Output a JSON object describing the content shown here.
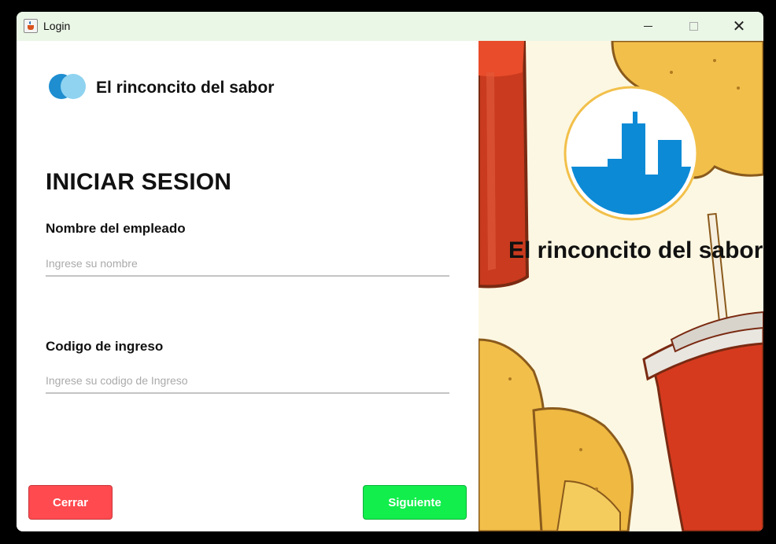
{
  "window": {
    "title": "Login",
    "controls": {
      "minimize": "minimize",
      "maximize": "maximize",
      "close": "✕"
    }
  },
  "brand": {
    "name": "El rinconcito del sabor"
  },
  "login": {
    "heading": "INICIAR SESION",
    "employee_label": "Nombre del empleado",
    "employee_placeholder": "Ingrese su nombre",
    "code_label": "Codigo de ingreso",
    "code_placeholder": "Ingrese su codigo de Ingreso"
  },
  "buttons": {
    "close_label": "Cerrar",
    "next_label": "Siguiente"
  },
  "colors": {
    "close_button": "#ff4a4f",
    "next_button": "#12ee4c",
    "logo_dark": "#1e8ed0",
    "logo_light": "#8fd3f0",
    "city_logo": "#0d8ad6"
  }
}
